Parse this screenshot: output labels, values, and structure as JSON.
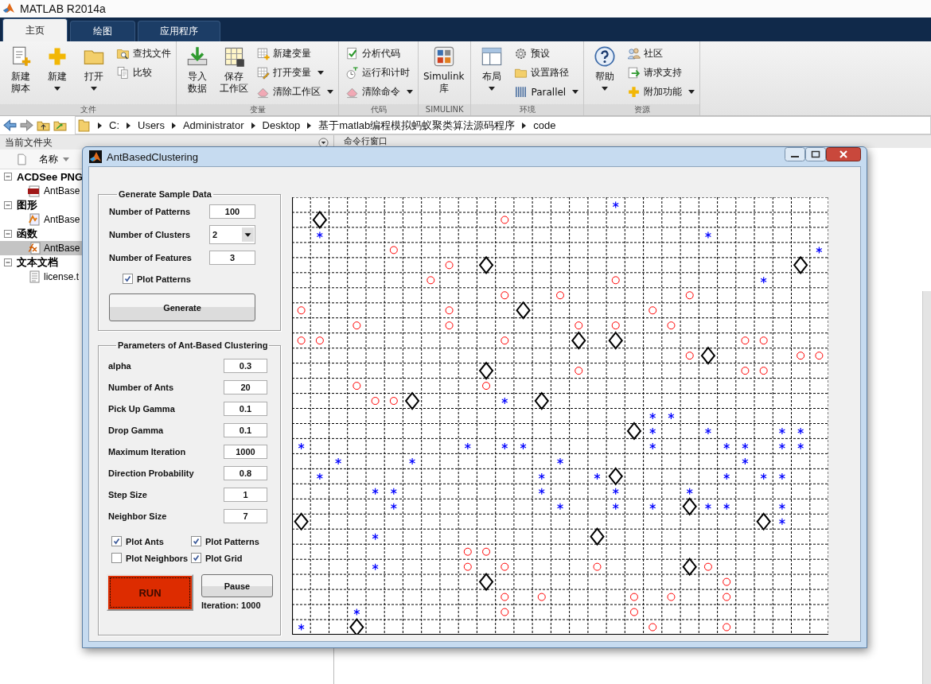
{
  "window": {
    "title": "MATLAB R2014a"
  },
  "ribbon_tabs": [
    {
      "label": "主页",
      "selected": true
    },
    {
      "label": "绘图",
      "selected": false
    },
    {
      "label": "应用程序",
      "selected": false
    }
  ],
  "ribbon_groups": [
    {
      "label": "文件",
      "large": [
        {
          "lines": [
            "新建",
            "脚本"
          ],
          "dropdown": false
        },
        {
          "lines": [
            "新建"
          ],
          "dropdown": true
        },
        {
          "lines": [
            "打开"
          ],
          "dropdown": true
        }
      ],
      "small": [
        {
          "label": "查找文件",
          "dropdown": false
        },
        {
          "label": "比较",
          "dropdown": false
        }
      ]
    },
    {
      "label": "变量",
      "large": [
        {
          "lines": [
            "导入",
            "数据"
          ],
          "dropdown": false
        },
        {
          "lines": [
            "保存",
            "工作区"
          ],
          "dropdown": false
        }
      ],
      "small": [
        {
          "label": "新建变量",
          "dropdown": false
        },
        {
          "label": "打开变量",
          "dropdown": true
        },
        {
          "label": "清除工作区",
          "dropdown": true
        }
      ]
    },
    {
      "label": "代码",
      "small": [
        {
          "label": "分析代码",
          "dropdown": false
        },
        {
          "label": "运行和计时",
          "dropdown": false
        },
        {
          "label": "清除命令",
          "dropdown": true
        }
      ]
    },
    {
      "label": "SIMULINK",
      "large": [
        {
          "lines": [
            "Simulink",
            "库"
          ],
          "dropdown": false
        }
      ]
    },
    {
      "label": "环境",
      "large": [
        {
          "lines": [
            "布局"
          ],
          "dropdown": true
        }
      ],
      "small": [
        {
          "label": "预设",
          "dropdown": false
        },
        {
          "label": "设置路径",
          "dropdown": false
        },
        {
          "label": "Parallel",
          "dropdown": true
        }
      ]
    },
    {
      "label": "资源",
      "large": [
        {
          "lines": [
            "帮助"
          ],
          "dropdown": true
        }
      ],
      "small": [
        {
          "label": "社区",
          "dropdown": false
        },
        {
          "label": "请求支持",
          "dropdown": false
        },
        {
          "label": "附加功能",
          "dropdown": true
        }
      ]
    }
  ],
  "address_bar": {
    "path": [
      "C:",
      "Users",
      "Administrator",
      "Desktop",
      "基于matlab编程模拟蚂蚁聚类算法源码程序",
      "code"
    ]
  },
  "file_panel": {
    "title": "当前文件夹",
    "column": "名称",
    "tree": [
      {
        "label": "ACDSee PNG",
        "expanded": true,
        "children": [
          {
            "label": "AntBase",
            "selected": false
          }
        ]
      },
      {
        "label": "图形",
        "expanded": true,
        "children": [
          {
            "label": "AntBase",
            "selected": false
          }
        ]
      },
      {
        "label": "函数",
        "expanded": true,
        "children": [
          {
            "label": "AntBase",
            "selected": true
          }
        ]
      },
      {
        "label": "文本文档",
        "expanded": true,
        "children": [
          {
            "label": "license.t",
            "selected": false
          }
        ]
      }
    ]
  },
  "command_window": {
    "title": "命令行窗口"
  },
  "dialog": {
    "title": "AntBasedClustering",
    "sample_data": {
      "title": "Generate Sample Data",
      "fields": [
        {
          "label": "Number of Patterns",
          "value": "100",
          "kind": "text"
        },
        {
          "label": "Number of Clusters",
          "value": "2",
          "kind": "dropdown"
        },
        {
          "label": "Number of Features",
          "value": "3",
          "kind": "text"
        }
      ],
      "checkbox": {
        "label": "Plot Patterns",
        "checked": true
      },
      "button": "Generate"
    },
    "parameters": {
      "title": "Parameters of Ant-Based Clustering",
      "fields": [
        {
          "label": "alpha",
          "value": "0.3"
        },
        {
          "label": "Number of Ants",
          "value": "20"
        },
        {
          "label": "Pick Up Gamma",
          "value": "0.1"
        },
        {
          "label": "Drop Gamma",
          "value": "0.1"
        },
        {
          "label": "Maximum Iteration",
          "value": "1000"
        },
        {
          "label": "Direction Probability",
          "value": "0.8"
        },
        {
          "label": "Step Size",
          "value": "1"
        },
        {
          "label": "Neighbor Size",
          "value": "7"
        }
      ],
      "checkboxes": [
        {
          "label": "Plot Ants",
          "checked": true
        },
        {
          "label": "Plot Patterns",
          "checked": true
        },
        {
          "label": "Plot Neighbors",
          "checked": false
        },
        {
          "label": "Plot Grid",
          "checked": true
        }
      ],
      "run_button": "RUN",
      "pause_button": "Pause",
      "status": "Iteration: 1000"
    }
  }
}
